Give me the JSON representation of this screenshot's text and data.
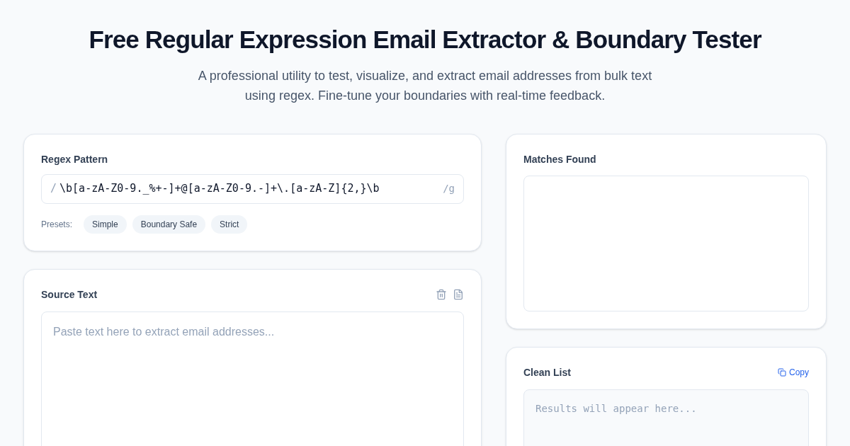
{
  "header": {
    "title": "Free Regular Expression Email Extractor & Boundary Tester",
    "subtitle": "A professional utility to test, visualize, and extract email addresses from bulk text using regex. Fine-tune your boundaries with real-time feedback."
  },
  "regex": {
    "label": "Regex Pattern",
    "prefix": "/",
    "value": "\\b[a-zA-Z0-9._%+-]+@[a-zA-Z0-9.-]+\\.[a-zA-Z]{2,}\\b",
    "flags": "/g",
    "presets_label": "Presets:",
    "presets": [
      "Simple",
      "Boundary Safe",
      "Strict"
    ]
  },
  "source": {
    "label": "Source Text",
    "placeholder": "Paste text here to extract email addresses..."
  },
  "matches": {
    "label": "Matches Found"
  },
  "clean_list": {
    "label": "Clean List",
    "copy_button": "Copy",
    "placeholder": "Results will appear here..."
  }
}
